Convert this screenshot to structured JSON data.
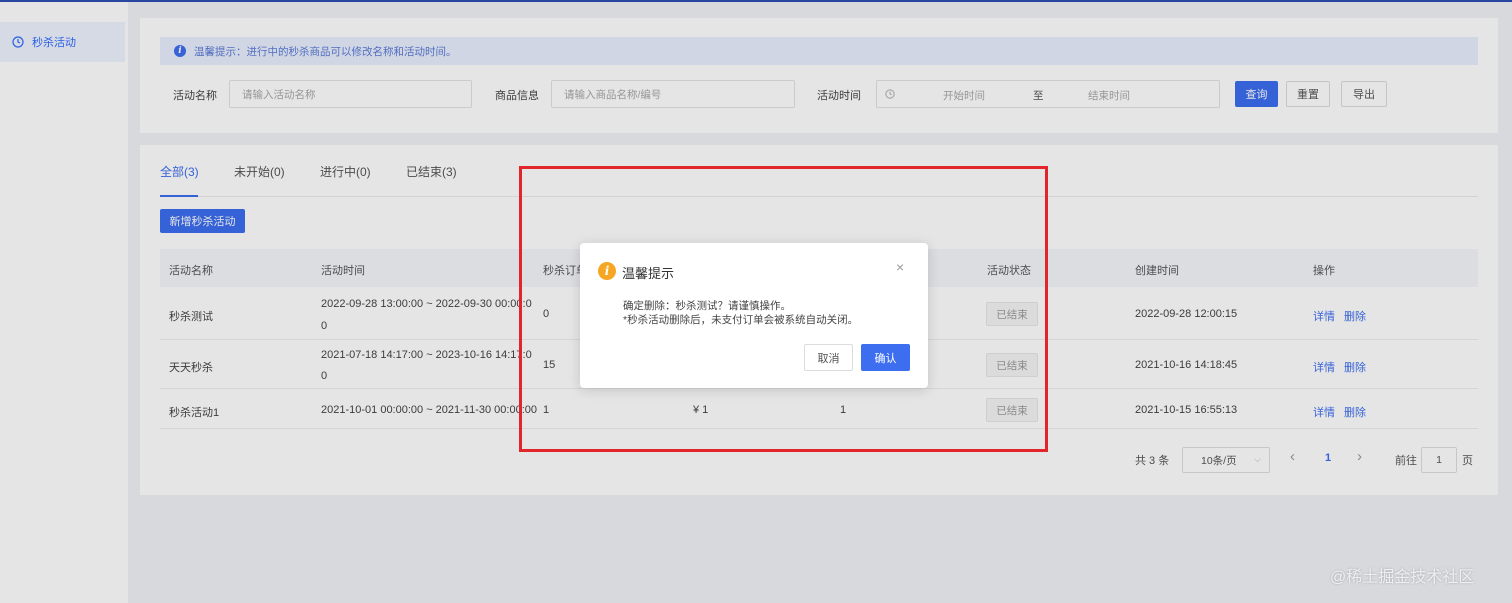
{
  "sidebar": {
    "item": "秒杀活动"
  },
  "notice": {
    "text": "温馨提示：进行中的秒杀商品可以修改名称和活动时间。"
  },
  "filters": {
    "name_label": "活动名称",
    "name_placeholder": "请输入活动名称",
    "goods_label": "商品信息",
    "goods_placeholder": "请输入商品名称/编号",
    "time_label": "活动时间",
    "start_placeholder": "开始时间",
    "separator": "至",
    "end_placeholder": "结束时间",
    "query": "查询",
    "reset": "重置",
    "export": "导出"
  },
  "tabs": [
    {
      "label": "全部(3)",
      "active": true
    },
    {
      "label": "未开始(0)",
      "active": false
    },
    {
      "label": "进行中(0)",
      "active": false
    },
    {
      "label": "已结束(3)",
      "active": false
    }
  ],
  "add_button": "新增秒杀活动",
  "table": {
    "headers": [
      "活动名称",
      "活动时间",
      "秒杀订单",
      "活动状态",
      "创建时间",
      "操作"
    ],
    "rows": [
      {
        "name": "秒杀测试",
        "time1": "2022-09-28 13:00:00 ~ 2022-09-30 00:00:0",
        "time2": "0",
        "orders": "0",
        "price": "",
        "count": "",
        "status": "已结束",
        "created": "2022-09-28 12:00:15",
        "detail": "详情",
        "delete": "删除"
      },
      {
        "name": "天天秒杀",
        "time1": "2021-07-18 14:17:00 ~ 2023-10-16 14:17:0",
        "time2": "0",
        "orders": "15",
        "price": "",
        "count": "",
        "status": "已结束",
        "created": "2021-10-16 14:18:45",
        "detail": "详情",
        "delete": "删除"
      },
      {
        "name": "秒杀活动1",
        "time1": "2021-10-01 00:00:00 ~ 2021-11-30 00:00:00",
        "time2": "",
        "orders": "1",
        "price": "¥ 1",
        "count": "1",
        "status": "已结束",
        "created": "2021-10-15 16:55:13",
        "detail": "详情",
        "delete": "删除"
      }
    ]
  },
  "pagination": {
    "total": "共 3 条",
    "page_size": "10条/页",
    "prev": "‹",
    "current": "1",
    "next": "›",
    "goto": "前往",
    "goto_value": "1",
    "page_unit": "页"
  },
  "dialog": {
    "title": "温馨提示",
    "line1": "确定删除：秒杀测试？请谨慎操作。",
    "line2": "*秒杀活动删除后，未支付订单会被系统自动关闭。",
    "cancel": "取消",
    "confirm": "确认",
    "close": "×"
  },
  "watermark": "@稀土掘金技术社区",
  "colors": {
    "primary": "#3d6ef0",
    "highlight": "#e1252a",
    "warning": "#f5a623"
  }
}
